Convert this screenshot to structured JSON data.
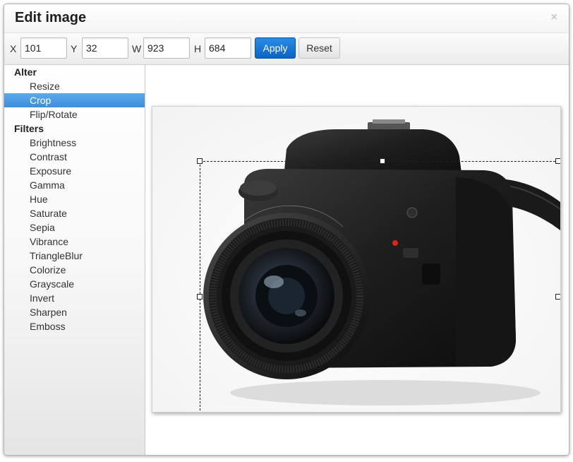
{
  "dialog": {
    "title": "Edit image",
    "close_label": "×"
  },
  "toolbar": {
    "x_label": "X",
    "x_value": "101",
    "y_label": "Y",
    "y_value": "32",
    "w_label": "W",
    "w_value": "923",
    "h_label": "H",
    "h_value": "684",
    "apply_label": "Apply",
    "reset_label": "Reset"
  },
  "sidebar": {
    "alter_title": "Alter",
    "alter_items": [
      "Resize",
      "Crop",
      "Flip/Rotate"
    ],
    "filters_title": "Filters",
    "filter_items": [
      "Brightness",
      "Contrast",
      "Exposure",
      "Gamma",
      "Hue",
      "Saturate",
      "Sepia",
      "Vibrance",
      "TriangleBlur",
      "Colorize",
      "Grayscale",
      "Invert",
      "Sharpen",
      "Emboss"
    ],
    "active_item": "Crop"
  },
  "colors": {
    "accent": "#3d8edb",
    "apply_button": "#0b64c6"
  },
  "icons": {
    "close": "close-icon"
  }
}
